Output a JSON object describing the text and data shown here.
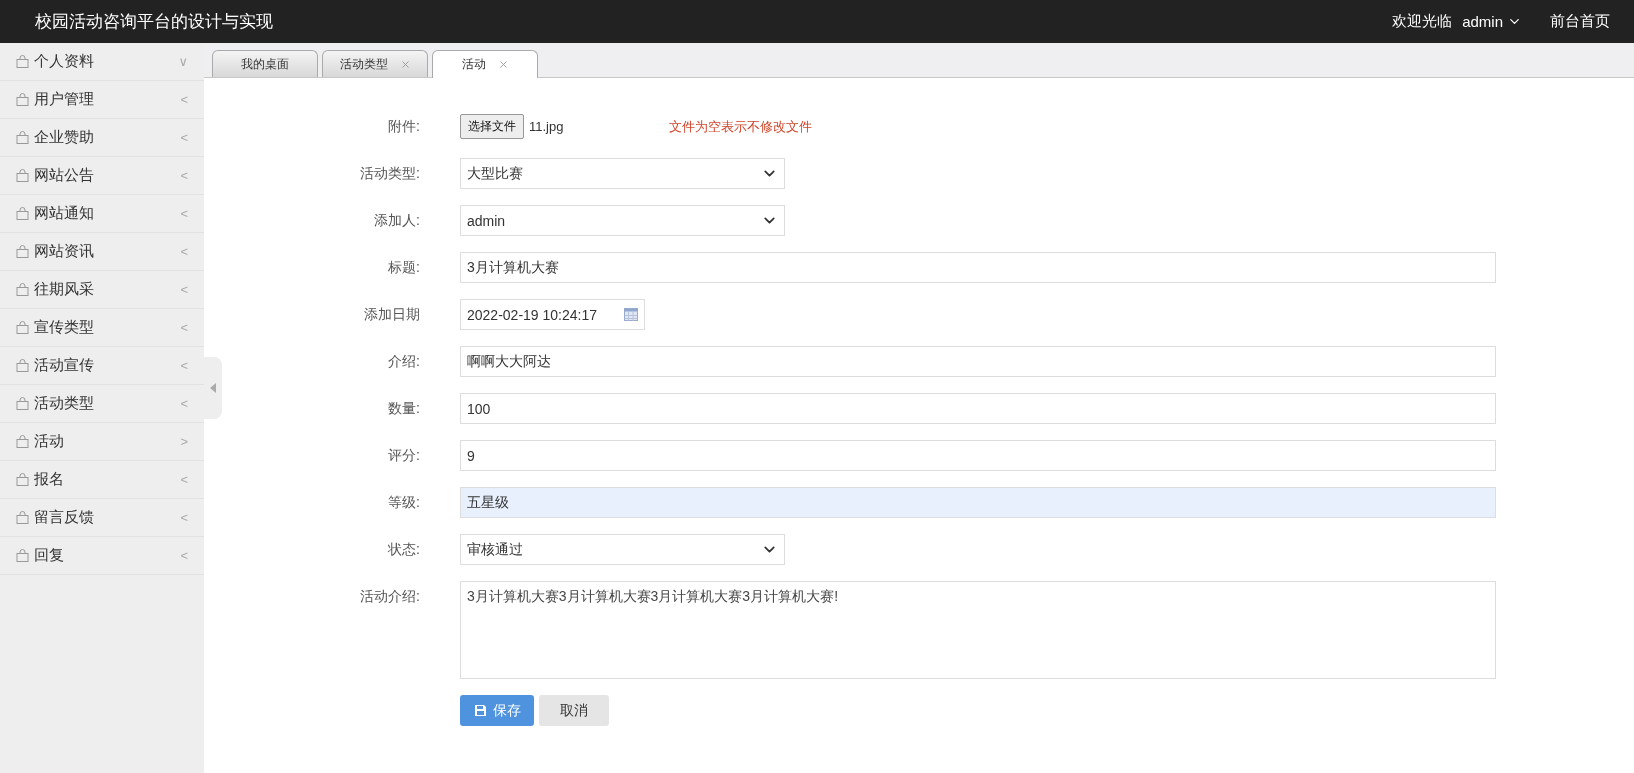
{
  "header": {
    "title": "校园活动咨询平台的设计与实现",
    "welcome": "欢迎光临",
    "user": "admin",
    "home_link": "前台首页"
  },
  "sidebar": {
    "items": [
      {
        "label": "个人资料",
        "arrow": "∨"
      },
      {
        "label": "用户管理",
        "arrow": "<"
      },
      {
        "label": "企业赞助",
        "arrow": "<"
      },
      {
        "label": "网站公告",
        "arrow": "<"
      },
      {
        "label": "网站通知",
        "arrow": "<"
      },
      {
        "label": "网站资讯",
        "arrow": "<"
      },
      {
        "label": "往期风采",
        "arrow": "<"
      },
      {
        "label": "宣传类型",
        "arrow": "<"
      },
      {
        "label": "活动宣传",
        "arrow": "<"
      },
      {
        "label": "活动类型",
        "arrow": "<"
      },
      {
        "label": "活动",
        "arrow": ">"
      },
      {
        "label": "报名",
        "arrow": "<"
      },
      {
        "label": "留言反馈",
        "arrow": "<"
      },
      {
        "label": "回复",
        "arrow": "<"
      }
    ]
  },
  "tabs": [
    {
      "label": "我的桌面",
      "selected": false,
      "closable": false
    },
    {
      "label": "活动类型",
      "selected": false,
      "closable": true
    },
    {
      "label": "活动",
      "selected": true,
      "closable": true
    }
  ],
  "form": {
    "fields": [
      {
        "kind": "file",
        "label": "附件:",
        "button": "选择文件",
        "value": "11.jpg",
        "hint": "文件为空表示不修改文件"
      },
      {
        "kind": "select",
        "label": "活动类型:",
        "value": "大型比赛",
        "autofilled": false
      },
      {
        "kind": "select",
        "label": "添加人:",
        "value": "admin",
        "autofilled": false
      },
      {
        "kind": "text",
        "label": "标题:",
        "value": "3月计算机大赛",
        "autofilled": false
      },
      {
        "kind": "date",
        "label": "添加日期",
        "value": "2022-02-19 10:24:17",
        "autofilled": false
      },
      {
        "kind": "text",
        "label": "介绍:",
        "value": "啊啊大大阿达",
        "autofilled": false
      },
      {
        "kind": "text",
        "label": "数量:",
        "value": "100",
        "autofilled": false
      },
      {
        "kind": "text",
        "label": "评分:",
        "value": "9",
        "autofilled": false
      },
      {
        "kind": "text",
        "label": "等级:",
        "value": "五星级",
        "autofilled": true
      },
      {
        "kind": "select",
        "label": "状态:",
        "value": "审核通过",
        "autofilled": false
      },
      {
        "kind": "textarea",
        "label": "活动介绍:",
        "value": "3月计算机大赛3月计算机大赛3月计算机大赛3月计算机大赛!",
        "autofilled": false
      }
    ],
    "buttons": [
      {
        "kind": "primary",
        "label": "保存"
      },
      {
        "kind": "secondary",
        "label": "取消"
      }
    ]
  }
}
